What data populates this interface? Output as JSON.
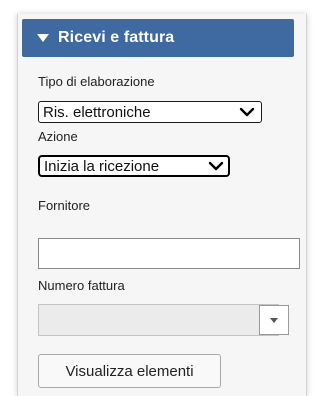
{
  "panel": {
    "title": "Ricevi e fattura",
    "accent_color": "#3e6aa1",
    "header_icon": "caret-down-icon"
  },
  "form": {
    "processing_type": {
      "label": "Tipo di elaborazione",
      "value": "Ris. elettroniche"
    },
    "action": {
      "label": "Azione",
      "value": "Inizia la ricezione"
    },
    "supplier": {
      "label": "Fornitore",
      "value": ""
    },
    "invoice_number": {
      "label": "Numero fattura",
      "value": ""
    },
    "view_items_button": "Visualizza elementi"
  }
}
